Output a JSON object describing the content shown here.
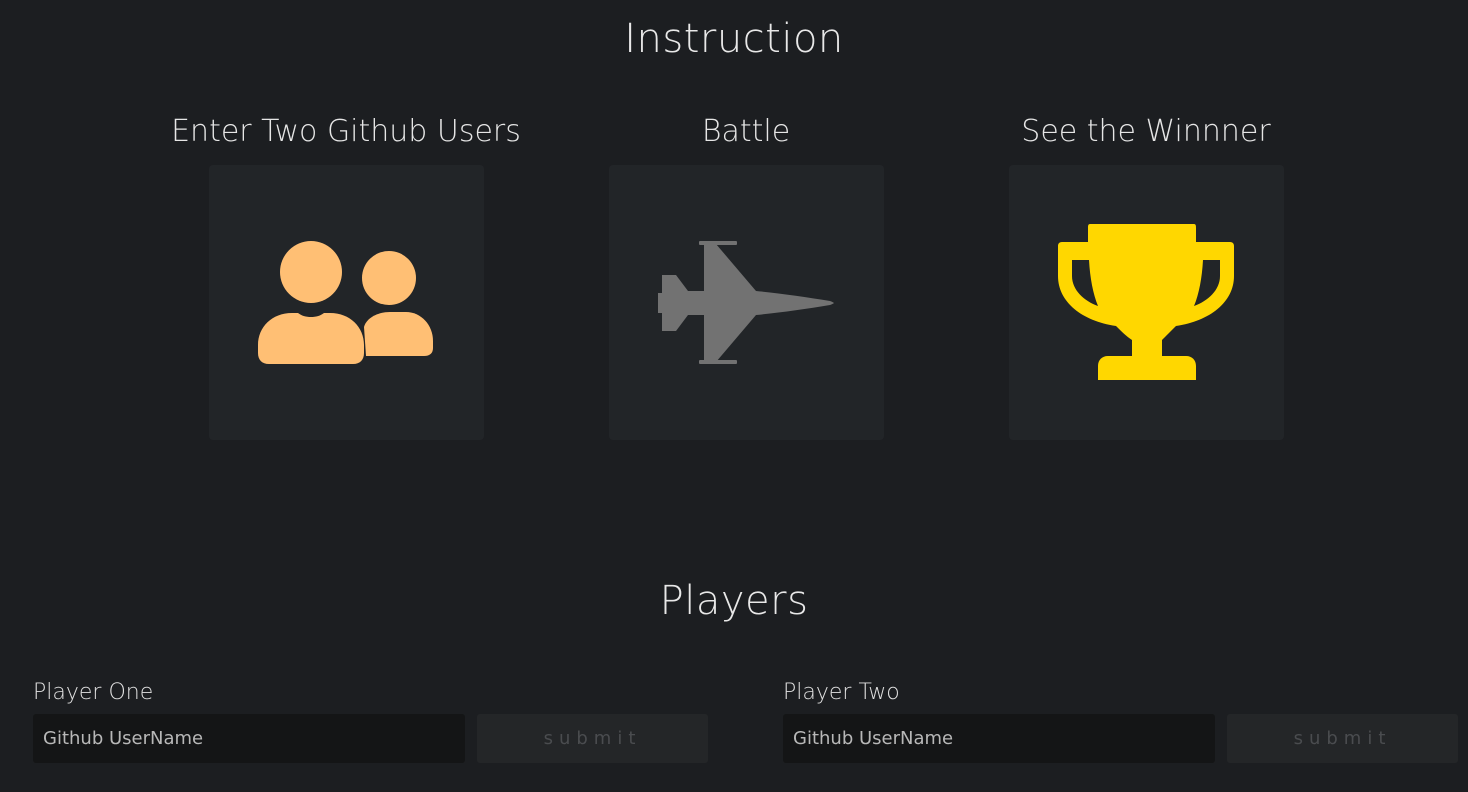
{
  "instruction": {
    "title": "Instruction",
    "steps": [
      {
        "title": "Enter Two Github Users",
        "icon": "users-icon",
        "color": "#ffbf74"
      },
      {
        "title": "Battle",
        "icon": "fighter-jet-icon",
        "color": "#727272"
      },
      {
        "title": "See the Winnner",
        "icon": "trophy-icon",
        "color": "#ffd700"
      }
    ]
  },
  "players": {
    "title": "Players",
    "player_one": {
      "label": "Player One",
      "placeholder": "Github UserName",
      "submit_label": "submit"
    },
    "player_two": {
      "label": "Player Two",
      "placeholder": "Github UserName",
      "submit_label": "submit"
    }
  }
}
